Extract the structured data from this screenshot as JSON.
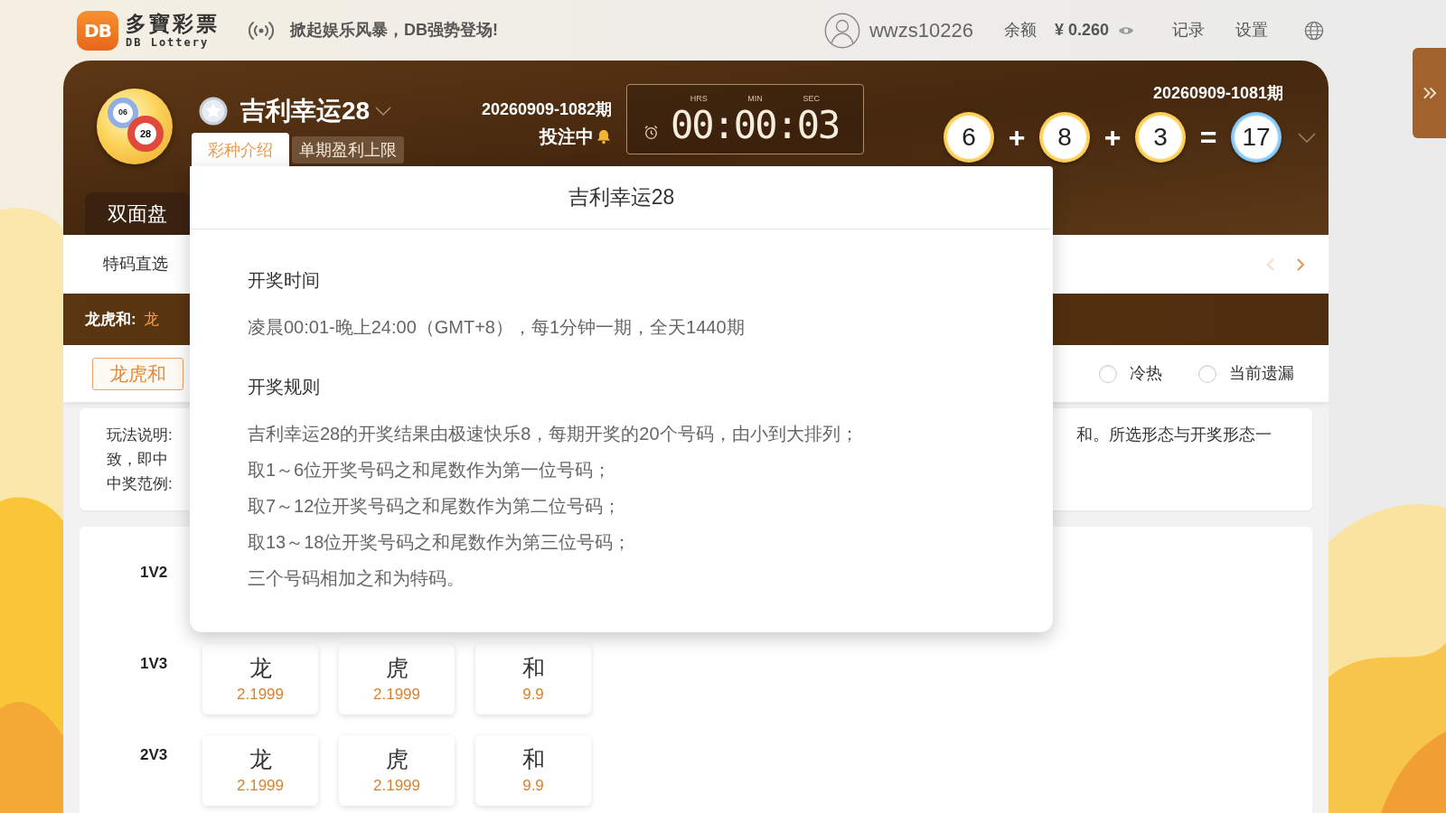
{
  "top_bar": {
    "logo": {
      "mark": "DB",
      "title": "多寶彩票",
      "subtitle": "DB Lottery"
    },
    "announcement": "掀起娱乐风暴，DB强势登场!",
    "username": "wwzs10226",
    "balance_label": "余额",
    "balance": "¥ 0.260",
    "links": [
      "记录",
      "设置"
    ]
  },
  "game_header": {
    "emblem_balls": [
      "06",
      "28"
    ],
    "name": "吉利幸运28",
    "tabs": [
      {
        "label": "彩种介绍",
        "selected": true
      },
      {
        "label": "单期盈利上限",
        "selected": false
      }
    ],
    "current_issue": "20260909-1082期",
    "status": "投注中",
    "timer": {
      "units": [
        "HRS",
        "MIN",
        "SEC"
      ],
      "value": "00:00:03"
    },
    "last_issue": "20260909-1081期",
    "result": [
      {
        "kind": "ball",
        "text": "6"
      },
      {
        "kind": "operator",
        "text": "+"
      },
      {
        "kind": "ball",
        "text": "8"
      },
      {
        "kind": "operator",
        "text": "+"
      },
      {
        "kind": "ball",
        "text": "3"
      },
      {
        "kind": "operator",
        "text": "="
      },
      {
        "kind": "sum",
        "text": "17"
      }
    ]
  },
  "play_tabs": [
    {
      "label": "双面盘",
      "selected": true
    }
  ],
  "sub_nav": {
    "items": [
      "特码直选"
    ],
    "arrows": [
      {
        "kind": "prev",
        "disabled": true
      },
      {
        "kind": "next",
        "disabled": false
      }
    ]
  },
  "category_bar": {
    "label": "龙虎和:",
    "value": "龙"
  },
  "options": {
    "chips": [
      {
        "label": "龙虎和",
        "selected": true
      }
    ],
    "radios": [
      {
        "label": "冷热",
        "selected": false
      },
      {
        "label": "当前遗漏",
        "selected": false
      }
    ]
  },
  "rules_card": {
    "left_lines": [
      "玩法说明:",
      "致，即中",
      "中奖范例:"
    ],
    "right_lines": [
      "和。所选形态与开奖形态一"
    ]
  },
  "bet_rows": [
    {
      "label": "1V2"
    },
    {
      "label": "1V3",
      "cells": [
        {
          "name": "龙",
          "odds": "2.1999"
        },
        {
          "name": "虎",
          "odds": "2.1999"
        },
        {
          "name": "和",
          "odds": "9.9"
        }
      ]
    },
    {
      "label": "2V3",
      "cells": [
        {
          "name": "龙",
          "odds": "2.1999"
        },
        {
          "name": "虎",
          "odds": "2.1999"
        },
        {
          "name": "和",
          "odds": "9.9"
        }
      ]
    }
  ],
  "popup": {
    "title": "吉利幸运28",
    "sections": [
      {
        "heading": "开奖时间",
        "lines": [
          "凌晨00:01-晚上24:00（GMT+8），每1分钟一期，全天1440期"
        ]
      },
      {
        "heading": "开奖规则",
        "lines": [
          "吉利幸运28的开奖结果由极速快乐8，每期开奖的20个号码，由小到大排列；",
          "取1～6位开奖号码之和尾数作为第一位号码；",
          "取7～12位开奖号码之和尾数作为第二位号码；",
          "取13～18位开奖号码之和尾数作为第三位号码；",
          "三个号码相加之和为特码。"
        ]
      }
    ]
  }
}
